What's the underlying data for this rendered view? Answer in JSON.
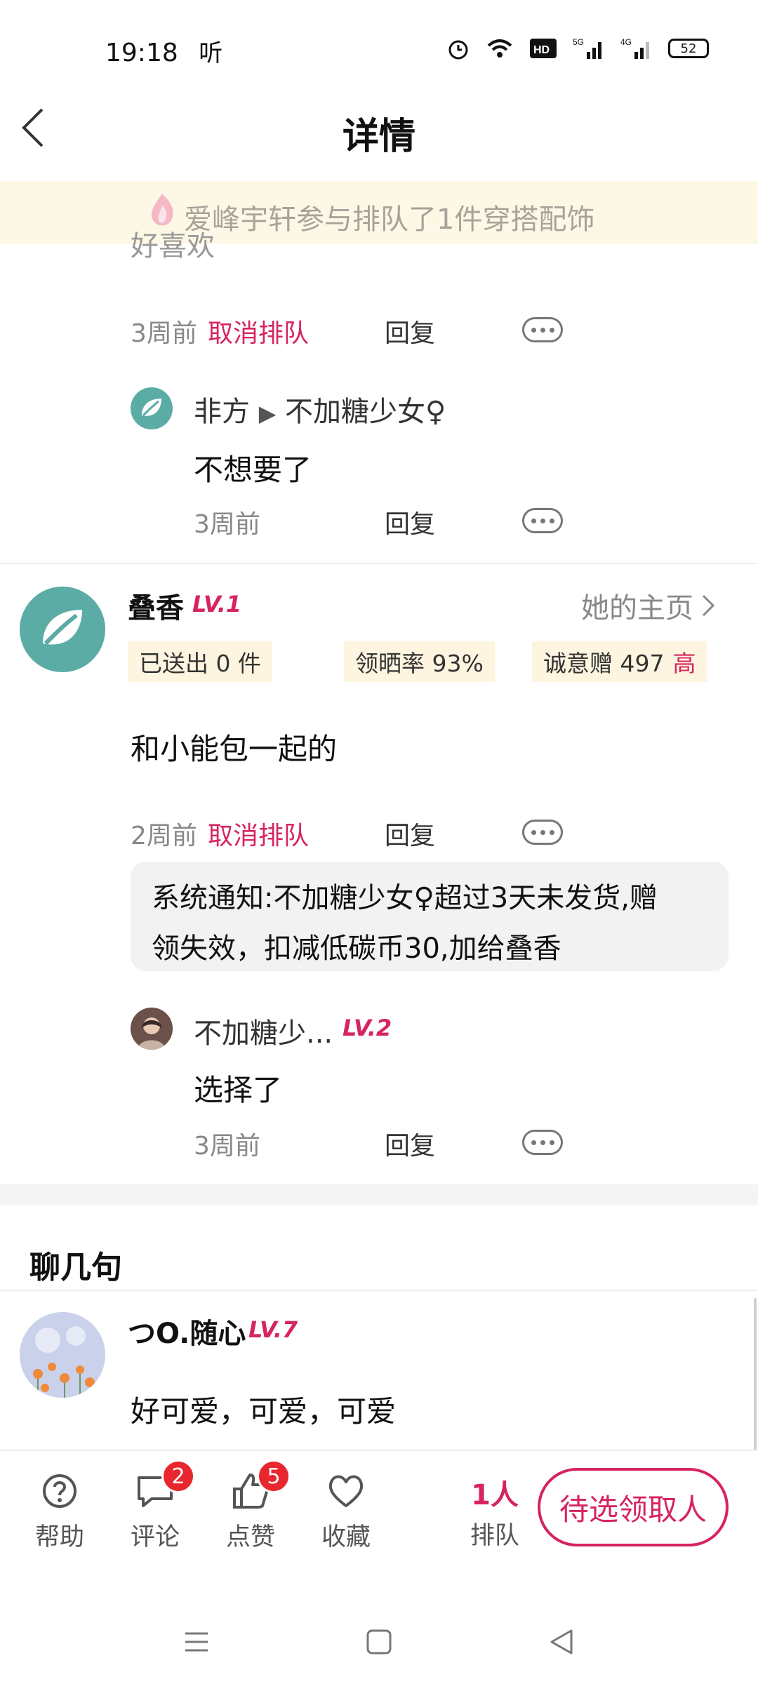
{
  "status": {
    "time": "19:18",
    "listen_icon": "听",
    "battery": "52"
  },
  "header": {
    "title": "详情"
  },
  "banner": {
    "text": "爱峰宇轩参与排队了1件穿搭配饰"
  },
  "first_comment": {
    "peek_text": "好喜欢",
    "time": "3周前",
    "cancel": "取消排队",
    "reply": "回复"
  },
  "nested_reply_1": {
    "from": "非方",
    "arrow": "▶",
    "to": "不加糖少女♀",
    "text": "不想要了",
    "time": "3周前",
    "reply": "回复"
  },
  "main_comment": {
    "user": "叠香",
    "level": "LV.1",
    "profile_link": "她的主页",
    "stats": {
      "sent": "已送出 0 件",
      "review_rate": "领晒率 93%",
      "sincerity_label": "诚意赠 497",
      "sincerity_level": "高"
    },
    "text": "和小能包一起的",
    "time": "2周前",
    "cancel": "取消排队",
    "reply": "回复",
    "system_notice_line1": "系统通知:不加糖少女♀超过3天未发货,赠",
    "system_notice_line2": "领失效，扣减低碳币30,加给叠香"
  },
  "nested_reply_2": {
    "user": "不加糖少...",
    "level": "LV.2",
    "text": "选择了",
    "time": "3周前",
    "reply": "回复"
  },
  "chat_section": {
    "title": "聊几句",
    "user": "つO.随心",
    "level": "LV.7",
    "text": "好可爱，可爱，可爱"
  },
  "bottom_bar": {
    "help": "帮助",
    "comment": "评论",
    "comment_badge": "2",
    "like": "点赞",
    "like_badge": "5",
    "favorite": "收藏",
    "queue_count": "1人",
    "queue_label": "排队",
    "pick_button": "待选领取人"
  },
  "colors": {
    "accent": "#d6245f",
    "banner_bg": "#fdf8e6",
    "chip_bg": "#fdf5df",
    "badge": "#e8262e"
  }
}
